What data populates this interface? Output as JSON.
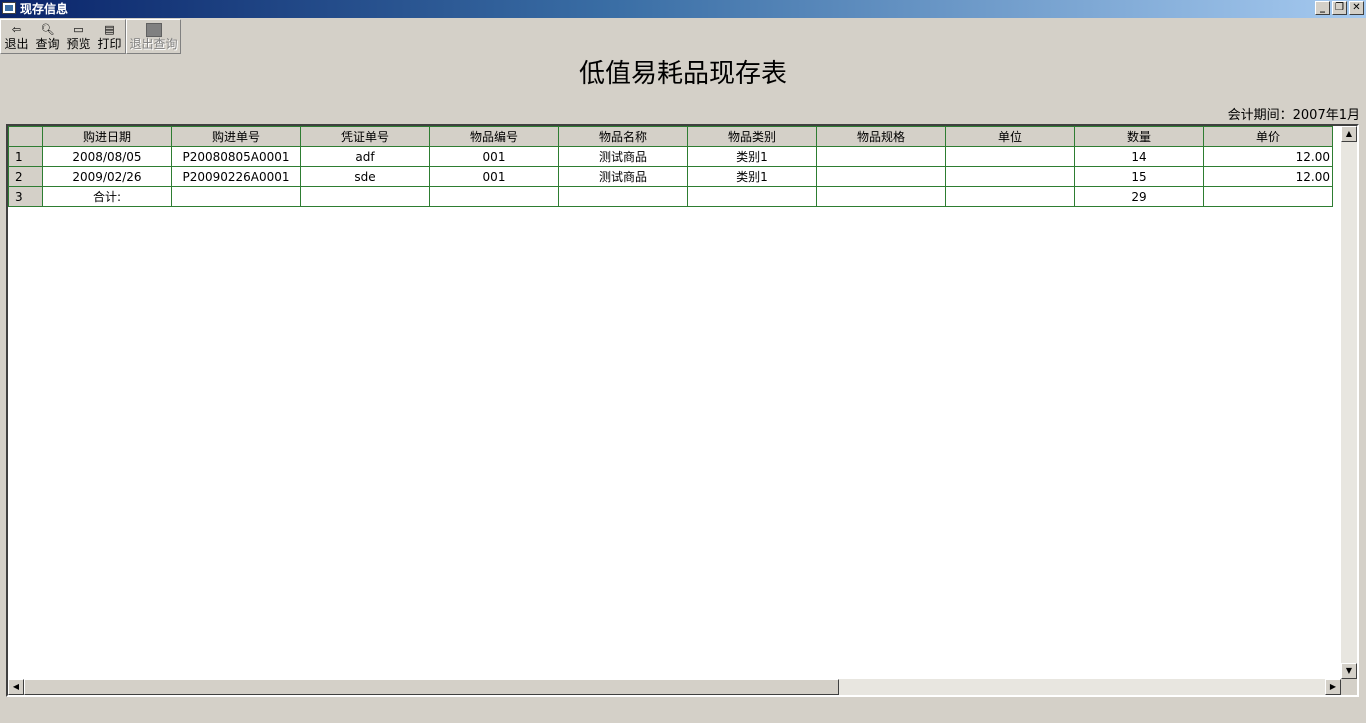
{
  "window": {
    "title": "现存信息",
    "minimize": "_",
    "restore": "❐",
    "close": "✕"
  },
  "toolbar": {
    "exit": "退出",
    "query": "查询",
    "preview": "预览",
    "print": "打印",
    "exit_query": "退出查询"
  },
  "report": {
    "title": "低值易耗品现存表",
    "period_label": "会计期间：",
    "period_value": "2007年1月"
  },
  "grid": {
    "headers": [
      "购进日期",
      "购进单号",
      "凭证单号",
      "物品编号",
      "物品名称",
      "物品类别",
      "物品规格",
      "单位",
      "数量",
      "单价"
    ],
    "rows": [
      {
        "num": "1",
        "cells": [
          "2008/08/05",
          "P20080805A0001",
          "adf",
          "001",
          "测试商品",
          "类别1",
          "",
          "",
          "14",
          "12.00"
        ]
      },
      {
        "num": "2",
        "cells": [
          "2009/02/26",
          "P20090226A0001",
          "sde",
          "001",
          "测试商品",
          "类别1",
          "",
          "",
          "15",
          "12.00"
        ]
      },
      {
        "num": "3",
        "cells": [
          "合计:",
          "",
          "",
          "",
          "",
          "",
          "",
          "",
          "29",
          ""
        ]
      }
    ]
  }
}
